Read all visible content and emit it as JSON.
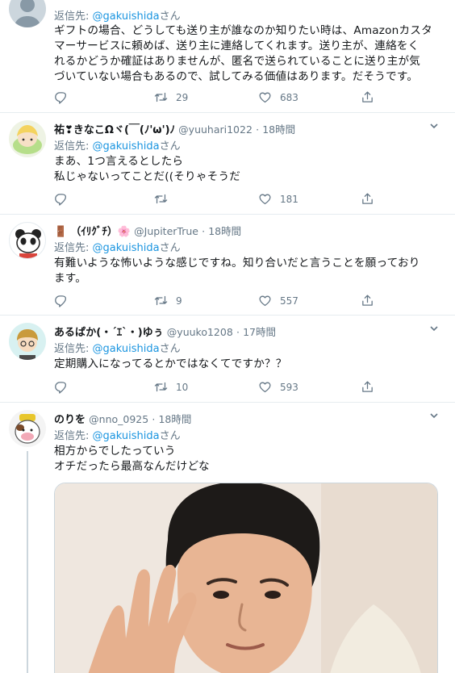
{
  "tweets": [
    {
      "reply_prefix": "返信先: ",
      "reply_to": "@gakuishida",
      "reply_suffix": "さん",
      "lines": [
        "ギフトの場合、どうしても送り主が誰なのか知りたい時は、Amazonカスタ",
        "マーサービスに頼めば、送り主に連絡してくれます。送り主が、連絡をく",
        "れるかどうか確証はありませんが、匿名で送られていることに送り主が気",
        "づいていない場合もあるので、試してみる価値はあります。だそうです。"
      ],
      "retweets": "29",
      "likes": "683"
    },
    {
      "name": "祐❣きなこΩヾ(￣(ﾉ'ω')ﾉ",
      "handle": "@yuuhari1022",
      "dot": "·",
      "time": "18時間",
      "reply_prefix": "返信先: ",
      "reply_to": "@gakuishida",
      "reply_suffix": "さん",
      "lines": [
        "まあ、1つ言えるとしたら",
        "私じゃないってことだ((そりゃそうだ"
      ],
      "retweets": "",
      "likes": "181"
    },
    {
      "name_icon": "🚪",
      "name": "（ｲﾘｸﾞﾁ）🌸",
      "handle": "@JupiterTrue",
      "dot": "·",
      "time": "18時間",
      "reply_prefix": "返信先: ",
      "reply_to": "@gakuishida",
      "reply_suffix": "さん",
      "lines": [
        "有難いような怖いような感じですね。知り合いだと言うことを願っており",
        "ます。"
      ],
      "retweets": "9",
      "likes": "557"
    },
    {
      "name": "あるぱか(・´ｴ`・)ゆぅ",
      "handle": "@yuuko1208",
      "dot": "·",
      "time": "17時間",
      "reply_prefix": "返信先: ",
      "reply_to": "@gakuishida",
      "reply_suffix": "さん",
      "lines": [
        "定期購入になってるとかではなくてですか？？"
      ],
      "retweets": "10",
      "likes": "593"
    },
    {
      "name": "のりを",
      "handle": "@nno_0925",
      "dot": "·",
      "time": "18時間",
      "reply_prefix": "返信先: ",
      "reply_to": "@gakuishida",
      "reply_suffix": "さん",
      "lines": [
        "相方からでしたっていう",
        "オチだったら最高なんだけどな"
      ]
    }
  ],
  "colors": {
    "link": "#1b95e0",
    "muted": "#657786",
    "border": "#e6ecf0"
  },
  "icons": [
    "reply-icon",
    "retweet-icon",
    "like-icon",
    "share-icon",
    "chevron-down-icon"
  ]
}
